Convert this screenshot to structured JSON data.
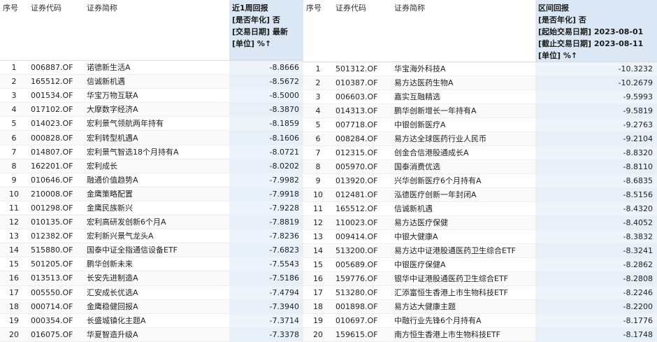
{
  "left": {
    "headers": {
      "idx": "序号",
      "code": "证券代码",
      "name": "证券简称",
      "ret_lines": [
        "近1周回报",
        "[是否年化] 否",
        "[交易日期] 最新",
        "[单位] %↑"
      ]
    },
    "rows": [
      {
        "idx": "1",
        "code": "006887.OF",
        "name": "诺德新生活A",
        "ret": "-8.8666"
      },
      {
        "idx": "2",
        "code": "165512.OF",
        "name": "信诚新机遇",
        "ret": "-8.5672"
      },
      {
        "idx": "3",
        "code": "001534.OF",
        "name": "华宝万物互联A",
        "ret": "-8.5000"
      },
      {
        "idx": "4",
        "code": "017102.OF",
        "name": "大摩数字经济A",
        "ret": "-8.3870"
      },
      {
        "idx": "5",
        "code": "014023.OF",
        "name": "宏利景气领航两年持有",
        "ret": "-8.1859"
      },
      {
        "idx": "6",
        "code": "000828.OF",
        "name": "宏利转型机遇A",
        "ret": "-8.1606"
      },
      {
        "idx": "7",
        "code": "014807.OF",
        "name": "宏利景气智选18个月持有A",
        "ret": "-8.0721"
      },
      {
        "idx": "8",
        "code": "162201.OF",
        "name": "宏利成长",
        "ret": "-8.0202"
      },
      {
        "idx": "9",
        "code": "010646.OF",
        "name": "融通价值趋势A",
        "ret": "-7.9982"
      },
      {
        "idx": "10",
        "code": "210008.OF",
        "name": "金鹰策略配置",
        "ret": "-7.9918"
      },
      {
        "idx": "11",
        "code": "001298.OF",
        "name": "金鹰民族新兴",
        "ret": "-7.9228"
      },
      {
        "idx": "12",
        "code": "010135.OF",
        "name": "宏利高研发创新6个月A",
        "ret": "-7.8819"
      },
      {
        "idx": "13",
        "code": "012382.OF",
        "name": "宏利新兴景气龙头A",
        "ret": "-7.8236"
      },
      {
        "idx": "14",
        "code": "515880.OF",
        "name": "国泰中证全指通信设备ETF",
        "ret": "-7.6823"
      },
      {
        "idx": "15",
        "code": "501205.OF",
        "name": "鹏华创新未来",
        "ret": "-7.5543"
      },
      {
        "idx": "16",
        "code": "013513.OF",
        "name": "长安先进制造A",
        "ret": "-7.5186"
      },
      {
        "idx": "17",
        "code": "005550.OF",
        "name": "汇安成长优选A",
        "ret": "-7.4794"
      },
      {
        "idx": "18",
        "code": "000714.OF",
        "name": "金鹰稳健回报A",
        "ret": "-7.3940"
      },
      {
        "idx": "19",
        "code": "000354.OF",
        "name": "长盛城镇化主题A",
        "ret": "-7.3714"
      },
      {
        "idx": "20",
        "code": "016075.OF",
        "name": "华夏智造升级A",
        "ret": "-7.3378"
      }
    ]
  },
  "right": {
    "headers": {
      "idx": "序号",
      "code": "证券代码",
      "name": "证券简称",
      "ret_lines": [
        "区间回报",
        "[是否年化] 否",
        "[起始交易日期] 2023-08-01",
        "[截止交易日期] 2023-08-11",
        "[单位] %↑"
      ]
    },
    "rows": [
      {
        "idx": "1",
        "code": "501312.OF",
        "name": "华宝海外科技A",
        "ret": "-10.3232"
      },
      {
        "idx": "2",
        "code": "010387.OF",
        "name": "易方达医药生物A",
        "ret": "-10.2679"
      },
      {
        "idx": "3",
        "code": "006603.OF",
        "name": "嘉实互融精选",
        "ret": "-9.5993"
      },
      {
        "idx": "4",
        "code": "014313.OF",
        "name": "鹏华创新增长一年持有A",
        "ret": "-9.5819"
      },
      {
        "idx": "5",
        "code": "007718.OF",
        "name": "中银创新医疗A",
        "ret": "-9.2763"
      },
      {
        "idx": "6",
        "code": "008284.OF",
        "name": "易方达全球医药行业人民币",
        "ret": "-9.2104"
      },
      {
        "idx": "7",
        "code": "012315.OF",
        "name": "创金合信港股通成长A",
        "ret": "-8.8320"
      },
      {
        "idx": "8",
        "code": "005970.OF",
        "name": "国泰消费优选",
        "ret": "-8.8110"
      },
      {
        "idx": "9",
        "code": "013920.OF",
        "name": "兴华创新医疗6个月持有A",
        "ret": "-8.6835"
      },
      {
        "idx": "10",
        "code": "012481.OF",
        "name": "泓德医疗创新一年封闭A",
        "ret": "-8.5156"
      },
      {
        "idx": "11",
        "code": "165512.OF",
        "name": "信诚新机遇",
        "ret": "-8.4320"
      },
      {
        "idx": "12",
        "code": "110023.OF",
        "name": "易方达医疗保健",
        "ret": "-8.4052"
      },
      {
        "idx": "13",
        "code": "009414.OF",
        "name": "中银大健康A",
        "ret": "-8.3832"
      },
      {
        "idx": "14",
        "code": "513200.OF",
        "name": "易方达中证港股通医药卫生综合ETF",
        "ret": "-8.3241"
      },
      {
        "idx": "15",
        "code": "005689.OF",
        "name": "中银医疗保健A",
        "ret": "-8.2862"
      },
      {
        "idx": "16",
        "code": "159776.OF",
        "name": "银华中证港股通医药卫生综合ETF",
        "ret": "-8.2808"
      },
      {
        "idx": "17",
        "code": "513280.OF",
        "name": "汇添富恒生香港上市生物科技ETF",
        "ret": "-8.2246"
      },
      {
        "idx": "18",
        "code": "001898.OF",
        "name": "易方达大健康主题",
        "ret": "-8.2200"
      },
      {
        "idx": "19",
        "code": "010697.OF",
        "name": "中融行业先锋6个月持有A",
        "ret": "-8.1776"
      },
      {
        "idx": "20",
        "code": "159615.OF",
        "name": "南方恒生香港上市生物科技ETF",
        "ret": "-8.1748"
      }
    ]
  }
}
